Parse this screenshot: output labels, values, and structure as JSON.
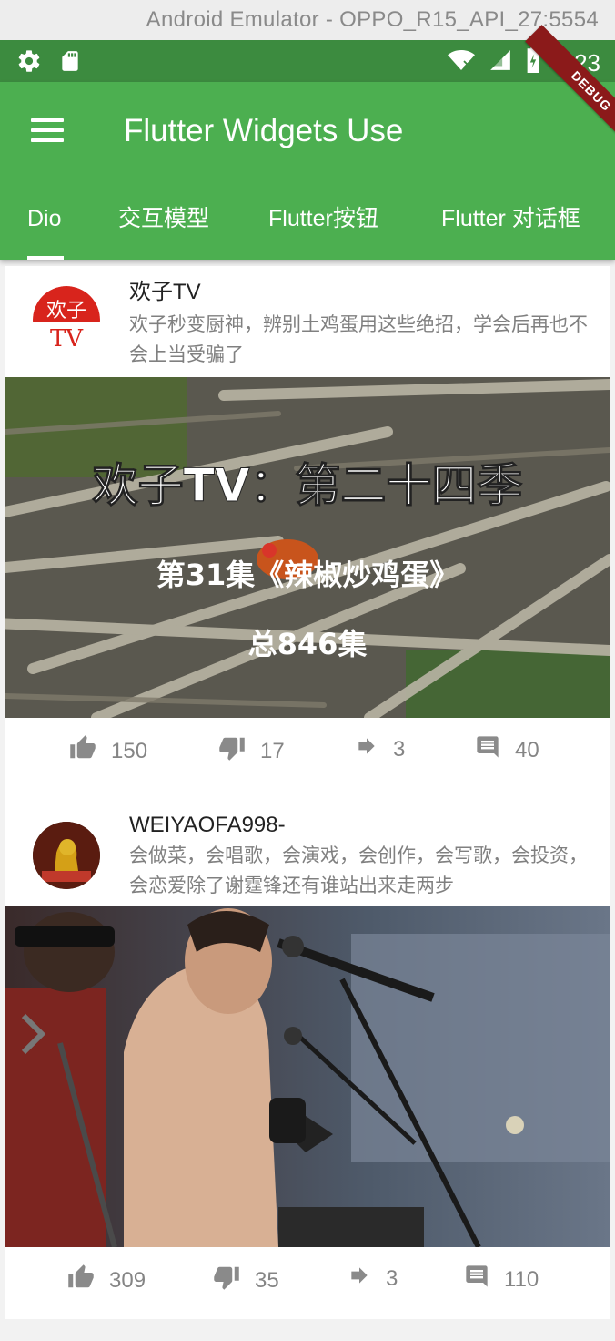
{
  "window": {
    "title": "Android Emulator - OPPO_R15_API_27:5554"
  },
  "status_bar": {
    "time": "3:23",
    "left_icons": [
      "gear-icon",
      "sd-card-icon"
    ],
    "right_icons": [
      "wifi-icon",
      "signal-icon",
      "battery-charging-icon"
    ]
  },
  "app_bar": {
    "title": "Flutter Widgets Use",
    "menu_icon": "menu-icon",
    "debug_banner": "DEBUG",
    "color": "#4caf50"
  },
  "tabs": [
    {
      "label": "Dio",
      "selected": true
    },
    {
      "label": "交互模型",
      "selected": false
    },
    {
      "label": "Flutter按钮",
      "selected": false
    },
    {
      "label": "Flutter 对话框",
      "selected": false
    }
  ],
  "posts": [
    {
      "author": "欢子TV",
      "avatar_text": [
        "欢子",
        "TV"
      ],
      "description": "欢子秒变厨神，辨别土鸡蛋用这些绝招，学会后再也不会上当受骗了",
      "thumbnail_lines": [
        "欢子TV：第二十四季",
        "第31集《辣椒炒鸡蛋》",
        "总846集"
      ],
      "likes": "150",
      "dislikes": "17",
      "shares": "3",
      "comments": "40"
    },
    {
      "author": "WEIYAOFA998-",
      "description": "会做菜，会唱歌，会演戏，会创作，会写歌，会投资，会恋爱除了谢霆锋还有谁站出来走两步",
      "likes": "309",
      "dislikes": "35",
      "shares": "3",
      "comments": "110"
    }
  ]
}
